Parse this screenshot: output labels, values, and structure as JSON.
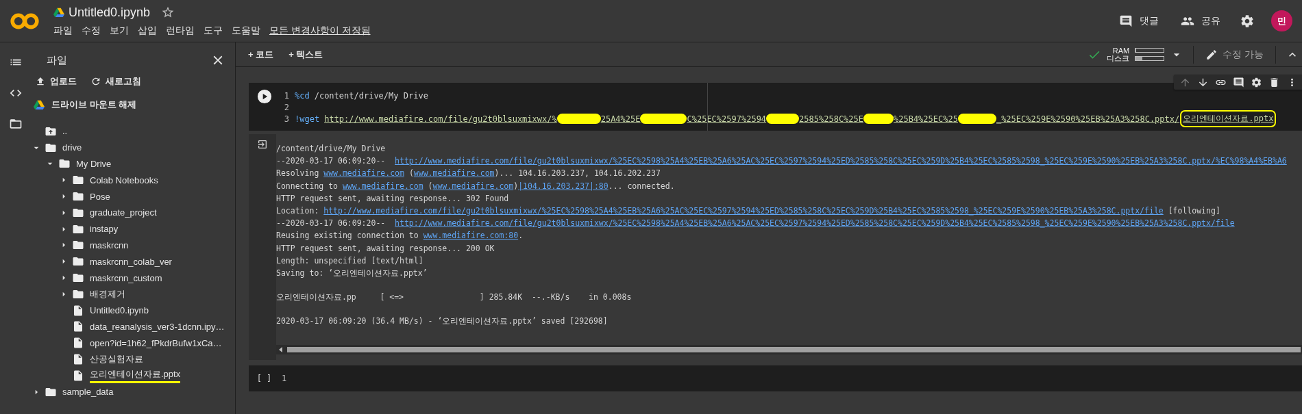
{
  "header": {
    "notebook_title": "Untitled0.ipynb",
    "menu": [
      "파일",
      "수정",
      "보기",
      "삽입",
      "런타임",
      "도구",
      "도움말"
    ],
    "save_status": "모든 변경사항이 저장됨",
    "comment_button": "댓글",
    "share_button": "공유",
    "avatar": "민"
  },
  "sidebar": {
    "title": "파일",
    "actions": [
      "업로드",
      "새로고침"
    ],
    "unmount": "드라이브 마운트 해제",
    "tree": [
      {
        "name": "..",
        "kind": "parent"
      },
      {
        "name": "drive",
        "kind": "folder",
        "expanded": true,
        "children": [
          {
            "name": "My Drive",
            "kind": "folder",
            "expanded": true,
            "children": [
              {
                "name": "Colab Notebooks",
                "kind": "folder",
                "expanded": false
              },
              {
                "name": "Pose",
                "kind": "folder",
                "expanded": false
              },
              {
                "name": "graduate_project",
                "kind": "folder",
                "expanded": false
              },
              {
                "name": "instapy",
                "kind": "folder",
                "expanded": false
              },
              {
                "name": "maskrcnn",
                "kind": "folder",
                "expanded": false
              },
              {
                "name": "maskrcnn_colab_ver",
                "kind": "folder",
                "expanded": false
              },
              {
                "name": "maskrcnn_custom",
                "kind": "folder",
                "expanded": false
              },
              {
                "name": "배경제거",
                "kind": "folder",
                "expanded": false
              },
              {
                "name": "Untitled0.ipynb",
                "kind": "file",
                "marked": false
              },
              {
                "name": "data_reanalysis_ver3-1dcnn.ipy…",
                "kind": "file",
                "marked": false
              },
              {
                "name": "open?id=1h62_fPkdrBufw1xCa…",
                "kind": "file",
                "marked": false
              },
              {
                "name": "산공실험자료",
                "kind": "file",
                "marked": false
              },
              {
                "name": "오리엔테이션자료.pptx",
                "kind": "file",
                "marked": true
              }
            ]
          }
        ]
      },
      {
        "name": "sample_data",
        "kind": "folder",
        "expanded": false
      }
    ]
  },
  "toolbar": {
    "add_code": "+ 코드",
    "add_text": "+ 텍스트",
    "connected": true,
    "resources": [
      {
        "label": "RAM",
        "level": 0.03
      },
      {
        "label": "디스크",
        "level": 0.25
      }
    ],
    "edit_mode": "수정 가능"
  },
  "code_cell": {
    "lines": [
      {
        "number": "1",
        "parts": [
          {
            "kind": "keyword",
            "text": "%cd"
          },
          {
            "kind": "plain",
            "text": "/content/drive/My Drive"
          }
        ]
      },
      {
        "number": "2"
      },
      {
        "number": "3",
        "parts": [
          {
            "kind": "keyword",
            "text": "!wget"
          },
          {
            "kind": "url",
            "text": "http://www.mediafire.com/file/gu2t0blsuxmixwx/%"
          },
          {
            "kind": "redaction"
          },
          {
            "kind": "url",
            "text": "25A4%25E"
          },
          {
            "kind": "redaction"
          },
          {
            "kind": "url",
            "text": "C%25EC%2597%2594"
          },
          {
            "kind": "redaction"
          },
          {
            "kind": "url",
            "text": "2585%258C%25E"
          },
          {
            "kind": "redaction"
          },
          {
            "kind": "url",
            "text": "%25B4%25EC%25"
          },
          {
            "kind": "redaction"
          },
          {
            "kind": "url",
            "text": "_%25EC%259E%2590%25EB%25A3%258C.pptx/"
          },
          {
            "kind": "url",
            "text": "오리엔테이션자료.pptx",
            "marked": true
          }
        ]
      }
    ]
  },
  "output": {
    "blocks": [
      [
        [
          {
            "kind": "text",
            "text": "/content/drive/My Drive"
          }
        ],
        [
          {
            "kind": "text",
            "text": "--2020-03-17 06:09:20--  "
          },
          {
            "kind": "link",
            "text": "http://www.mediafire.com/file/gu2t0blsuxmixwx/%25EC%2598%25A4%25EB%25A6%25AC%25EC%2597%2594%25ED%2585%258C%25EC%259D%25B4%25EC%2585%2598_%25EC%259E%2590%25EB%25A3%258C.pptx/%EC%98%A4%EB%A6"
          }
        ],
        [
          {
            "kind": "text",
            "text": "Resolving "
          },
          {
            "kind": "link",
            "text": "www.mediafire.com"
          },
          {
            "kind": "text",
            "text": " ("
          },
          {
            "kind": "link",
            "text": "www.mediafire.com"
          },
          {
            "kind": "text",
            "text": ")... 104.16.203.237, 104.16.202.237"
          }
        ],
        [
          {
            "kind": "text",
            "text": "Connecting to "
          },
          {
            "kind": "link",
            "text": "www.mediafire.com"
          },
          {
            "kind": "text",
            "text": " ("
          },
          {
            "kind": "link",
            "text": "www.mediafire.com"
          },
          {
            "kind": "text",
            "text": ")"
          },
          {
            "kind": "link",
            "text": "|104.16.203.237|:80"
          },
          {
            "kind": "text",
            "text": "... connected."
          }
        ],
        [
          {
            "kind": "text",
            "text": "HTTP request sent, awaiting response... 302 Found"
          }
        ],
        [
          {
            "kind": "text",
            "text": "Location: "
          },
          {
            "kind": "link",
            "text": "http://www.mediafire.com/file/gu2t0blsuxmixwx/%25EC%2598%25A4%25EB%25A6%25AC%25EC%2597%2594%25ED%2585%258C%25EC%259D%25B4%25EC%2585%2598_%25EC%259E%2590%25EB%25A3%258C.pptx/file"
          },
          {
            "kind": "text",
            "text": " [following]"
          }
        ],
        [
          {
            "kind": "text",
            "text": "--2020-03-17 06:09:20--  "
          },
          {
            "kind": "link",
            "text": "http://www.mediafire.com/file/gu2t0blsuxmixwx/%25EC%2598%25A4%25EB%25A6%25AC%25EC%2597%2594%25ED%2585%258C%25EC%259D%25B4%25EC%2585%2598_%25EC%259E%2590%25EB%25A3%258C.pptx/file"
          }
        ],
        [
          {
            "kind": "text",
            "text": "Reusing existing connection to "
          },
          {
            "kind": "link",
            "text": "www.mediafire.com:80"
          },
          {
            "kind": "text",
            "text": "."
          }
        ],
        [
          {
            "kind": "text",
            "text": "HTTP request sent, awaiting response... 200 OK"
          }
        ],
        [
          {
            "kind": "text",
            "text": "Length: unspecified [text/html]"
          }
        ],
        [
          {
            "kind": "text",
            "text": "Saving to: ‘오리엔테이션자료.pptx’"
          }
        ]
      ],
      [
        [
          {
            "kind": "text",
            "text": "오리엔테이션자료.pp     [ <=>                ] 285.84K  --.-KB/s    in 0.008s"
          }
        ]
      ],
      [
        [
          {
            "kind": "text",
            "text": "2020-03-17 06:09:20 (36.4 MB/s) - ‘오리엔테이션자료.pptx’ saved [292698]"
          }
        ]
      ]
    ]
  },
  "empty_cell": {
    "prompt": "[ ]",
    "line_number": "1"
  }
}
